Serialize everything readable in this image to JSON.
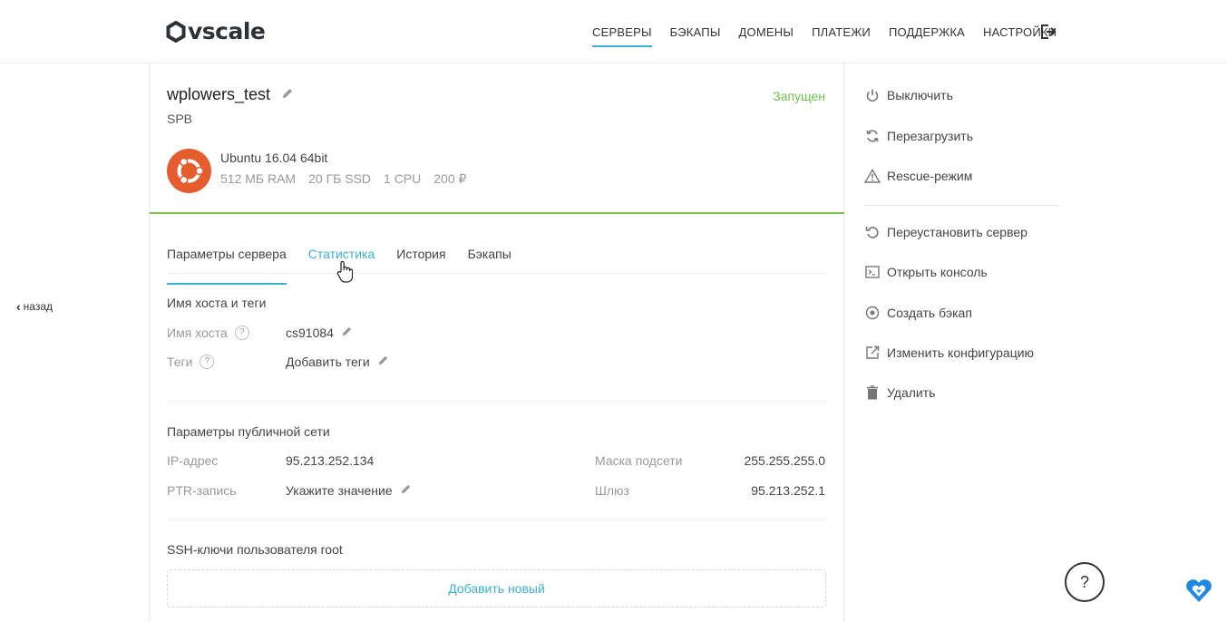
{
  "header": {
    "logo_text": "vscale",
    "nav": [
      "СЕРВЕРЫ",
      "БЭКАПЫ",
      "ДОМЕНЫ",
      "ПЛАТЕЖИ",
      "ПОДДЕРЖКА",
      "НАСТРОЙКИ"
    ],
    "active_nav": "СЕРВЕРЫ"
  },
  "back_label": "назад",
  "server": {
    "name": "wplowers_test",
    "region": "SPB",
    "status": "Запущен",
    "os": "Ubuntu 16.04 64bit",
    "ram": "512 МБ RAM",
    "disk": "20 ГБ SSD",
    "cpu": "1 CPU",
    "price": "200 ₽"
  },
  "tabs": [
    "Параметры сервера",
    "Статистика",
    "История",
    "Бэкапы"
  ],
  "hostname_section": {
    "title": "Имя хоста и теги",
    "hostname_label": "Имя хоста",
    "hostname_value": "cs91084",
    "tags_label": "Теги",
    "tags_value": "Добавить теги"
  },
  "network_section": {
    "title": "Параметры публичной сети",
    "ip_label": "IP-адрес",
    "ip_value": "95.213.252.134",
    "ptr_label": "PTR-запись",
    "ptr_value": "Укажите значение",
    "mask_label": "Маска подсети",
    "mask_value": "255.255.255.0",
    "gateway_label": "Шлюз",
    "gateway_value": "95.213.252.1"
  },
  "ssh_section": {
    "title": "SSH-ключи пользователя root",
    "add_label": "Добавить новый"
  },
  "actions": {
    "power_off": "Выключить",
    "restart": "Перезагрузить",
    "rescue": "Rescue-режим",
    "reinstall": "Переустановить сервер",
    "console": "Открыть консоль",
    "backup": "Создать бэкап",
    "resize": "Изменить конфигурацию",
    "delete": "Удалить"
  },
  "help_label": "?",
  "colors": {
    "accent": "#3bb0da",
    "status_green": "#6cc24a",
    "divider_green": "#7cc04b",
    "ubuntu_orange": "#e55d2e"
  }
}
